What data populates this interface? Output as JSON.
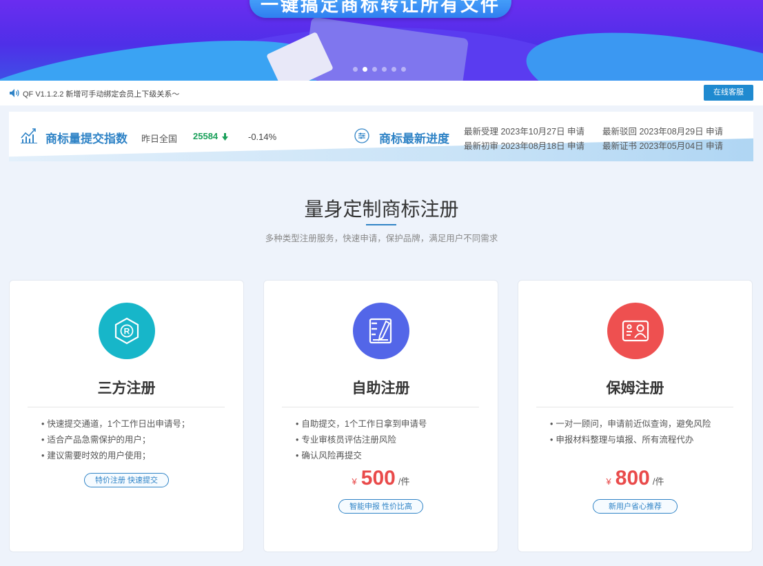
{
  "banner": {
    "slogan": "一键搞定商标转让所有文件",
    "carousel_count": 6,
    "carousel_active_index": 1
  },
  "notice": {
    "text": "QF V1.1.2.2 新增可手动绑定会员上下级关系～",
    "service_button": "在线客服"
  },
  "stats": {
    "submit_index_title": "商标量提交指数",
    "yesterday_label": "昨日全国",
    "count": "25584",
    "change": "-0.14%",
    "progress_title": "商标最新进度",
    "progress_items": [
      "最新受理 2023年10月27日 申请",
      "最新驳回 2023年08月29日 申请",
      "最新初审 2023年08月18日 申请",
      "最新证书 2023年05月04日 申请"
    ]
  },
  "section": {
    "title": "量身定制商标注册",
    "subtitle": "多种类型注册服务，快速申请，保护品牌，满足用户不同需求"
  },
  "cards": [
    {
      "title": "三方注册",
      "icon": "registered-trademark-icon",
      "color": "#17b6c9",
      "features": [
        "快速提交通道，1个工作日出申请号；",
        "适合产品急需保护的用户；",
        "建议需要时效的用户使用；"
      ],
      "tag": "特价注册 快速提交"
    },
    {
      "title": "自助注册",
      "icon": "edit-document-icon",
      "color": "#5366e8",
      "features": [
        "自助提交，1个工作日拿到申请号",
        "专业审核员评估注册风险",
        "确认风险再提交"
      ],
      "currency": "¥",
      "price": "500",
      "unit": "/件",
      "tag": "智能申报 性价比高"
    },
    {
      "title": "保姆注册",
      "icon": "id-card-user-icon",
      "color": "#ee5050",
      "features": [
        "一对一顾问，申请前近似查询，避免风险",
        "申报材料整理与填报、所有流程代办"
      ],
      "currency": "¥",
      "price": "800",
      "unit": "/件",
      "tag": "新用户省心推荐"
    }
  ]
}
